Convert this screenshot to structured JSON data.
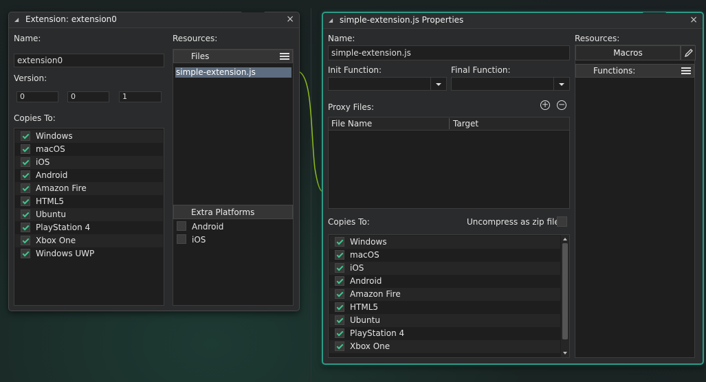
{
  "window1": {
    "title": "Extension: extension0",
    "name_label": "Name:",
    "name_value": "extension0",
    "version_label": "Version:",
    "version": [
      "0",
      "0",
      "1"
    ],
    "copies_label": "Copies To:",
    "platforms": [
      "Windows",
      "macOS",
      "iOS",
      "Android",
      "Amazon Fire",
      "HTML5",
      "Ubuntu",
      "PlayStation 4",
      "Xbox One",
      "Windows UWP"
    ],
    "resources_label": "Resources:",
    "files_header": "Files",
    "files": [
      "simple-extension.js"
    ],
    "extra_header": "Extra Platforms",
    "extra_platforms": [
      "Android",
      "iOS"
    ]
  },
  "window2": {
    "title": "simple-extension.js Properties",
    "name_label": "Name:",
    "name_value": "simple-extension.js",
    "init_label": "Init Function:",
    "final_label": "Final Function:",
    "proxy_label": "Proxy Files:",
    "col_file": "File Name",
    "col_target": "Target",
    "copies_label": "Copies To:",
    "uncompress_label": "Uncompress as zip file",
    "platforms": [
      "Windows",
      "macOS",
      "iOS",
      "Android",
      "Amazon Fire",
      "HTML5",
      "Ubuntu",
      "PlayStation 4",
      "Xbox One"
    ],
    "resources_label": "Resources:",
    "macros_label": "Macros",
    "functions_header": "Functions:"
  },
  "icons": {
    "close": "×",
    "add": "+",
    "remove": "−"
  },
  "colors": {
    "accent": "#2f9a86",
    "check": "#3fc78c",
    "wire": "#8fbf1e"
  }
}
